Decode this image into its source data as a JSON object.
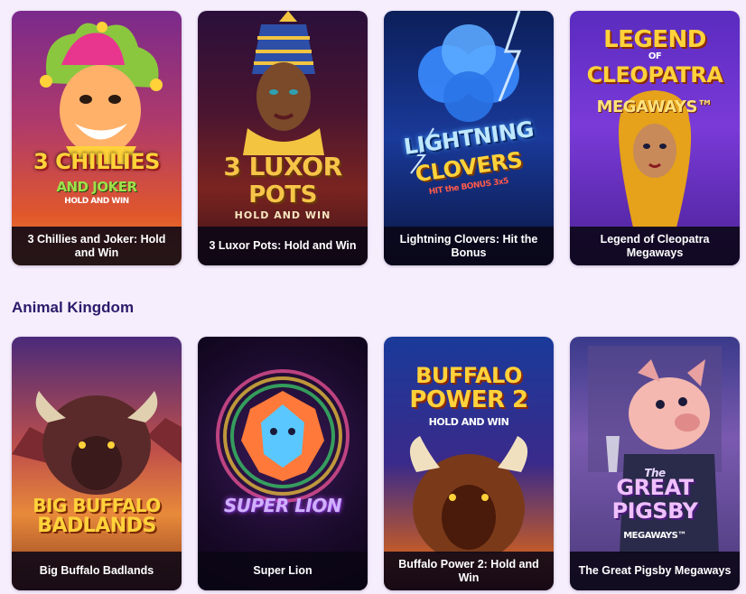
{
  "top_row": {
    "games": [
      {
        "title": "3 Chillies and Joker: Hold and Win",
        "art_title": "3 CHILLIES",
        "art_sub": "AND JOKER",
        "art_tag": "HOLD AND WIN"
      },
      {
        "title": "3 Luxor Pots: Hold and Win",
        "art_title": "3 LUXOR",
        "art_sub": "POTS",
        "art_tag": "HOLD AND WIN"
      },
      {
        "title": "Lightning Clovers: Hit the Bonus",
        "art_title": "LIGHTNING",
        "art_sub": "CLOVERS",
        "art_tag": "HIT the BONUS 3x5"
      },
      {
        "title": "Legend of Cleopatra Megaways",
        "art_title": "LEGEND",
        "art_sub": "CLEOPATRA",
        "art_tag": "MEGAWAYS™",
        "art_of": "OF"
      }
    ]
  },
  "section": {
    "title": "Animal Kingdom"
  },
  "bottom_row": {
    "games": [
      {
        "title": "Big Buffalo Badlands",
        "art_title": "BIG BUFFALO",
        "art_sub": "BADLANDS"
      },
      {
        "title": "Super Lion",
        "art_title": "SUPER LION"
      },
      {
        "title": "Buffalo Power 2: Hold and Win",
        "art_title": "BUFFALO",
        "art_sub": "POWER 2",
        "art_tag": "HOLD AND WIN"
      },
      {
        "title": "The Great Pigsby Megaways",
        "art_title": "GREAT",
        "art_sub": "PIGSBY",
        "art_tag": "MEGAWAYS™",
        "art_the": "The"
      }
    ]
  },
  "colors": {
    "page_bg": "#f6eefc",
    "section_title": "#2b1a6b",
    "caption_bg": "#0a0614",
    "caption_text": "#ffffff"
  }
}
